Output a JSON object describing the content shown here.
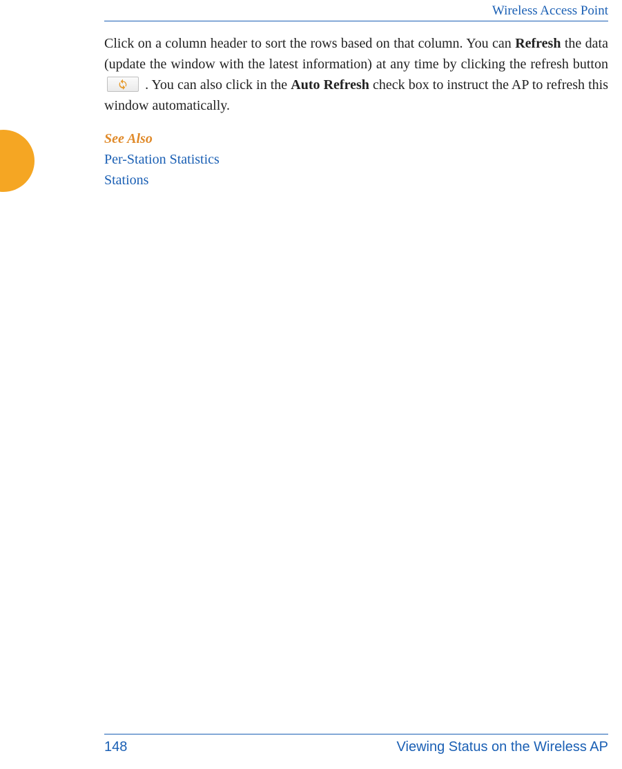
{
  "header": {
    "running_head": "Wireless Access Point"
  },
  "body": {
    "para_part1": "Click on a column header to sort the rows based on that column. You can ",
    "para_bold1": "Refresh",
    "para_part2": " the data (update the window with the latest information) at any time by clicking the refresh button ",
    "para_part3": " . You can also click in the ",
    "para_bold2": "Auto Refresh",
    "para_part4": " check box to instruct the AP to refresh this window automatically.",
    "refresh_icon_name": "refresh-icon"
  },
  "see_also": {
    "title": "See Also",
    "links": [
      "Per-Station Statistics",
      "Stations"
    ]
  },
  "footer": {
    "page_number": "148",
    "section_title": "Viewing Status on the Wireless AP"
  }
}
